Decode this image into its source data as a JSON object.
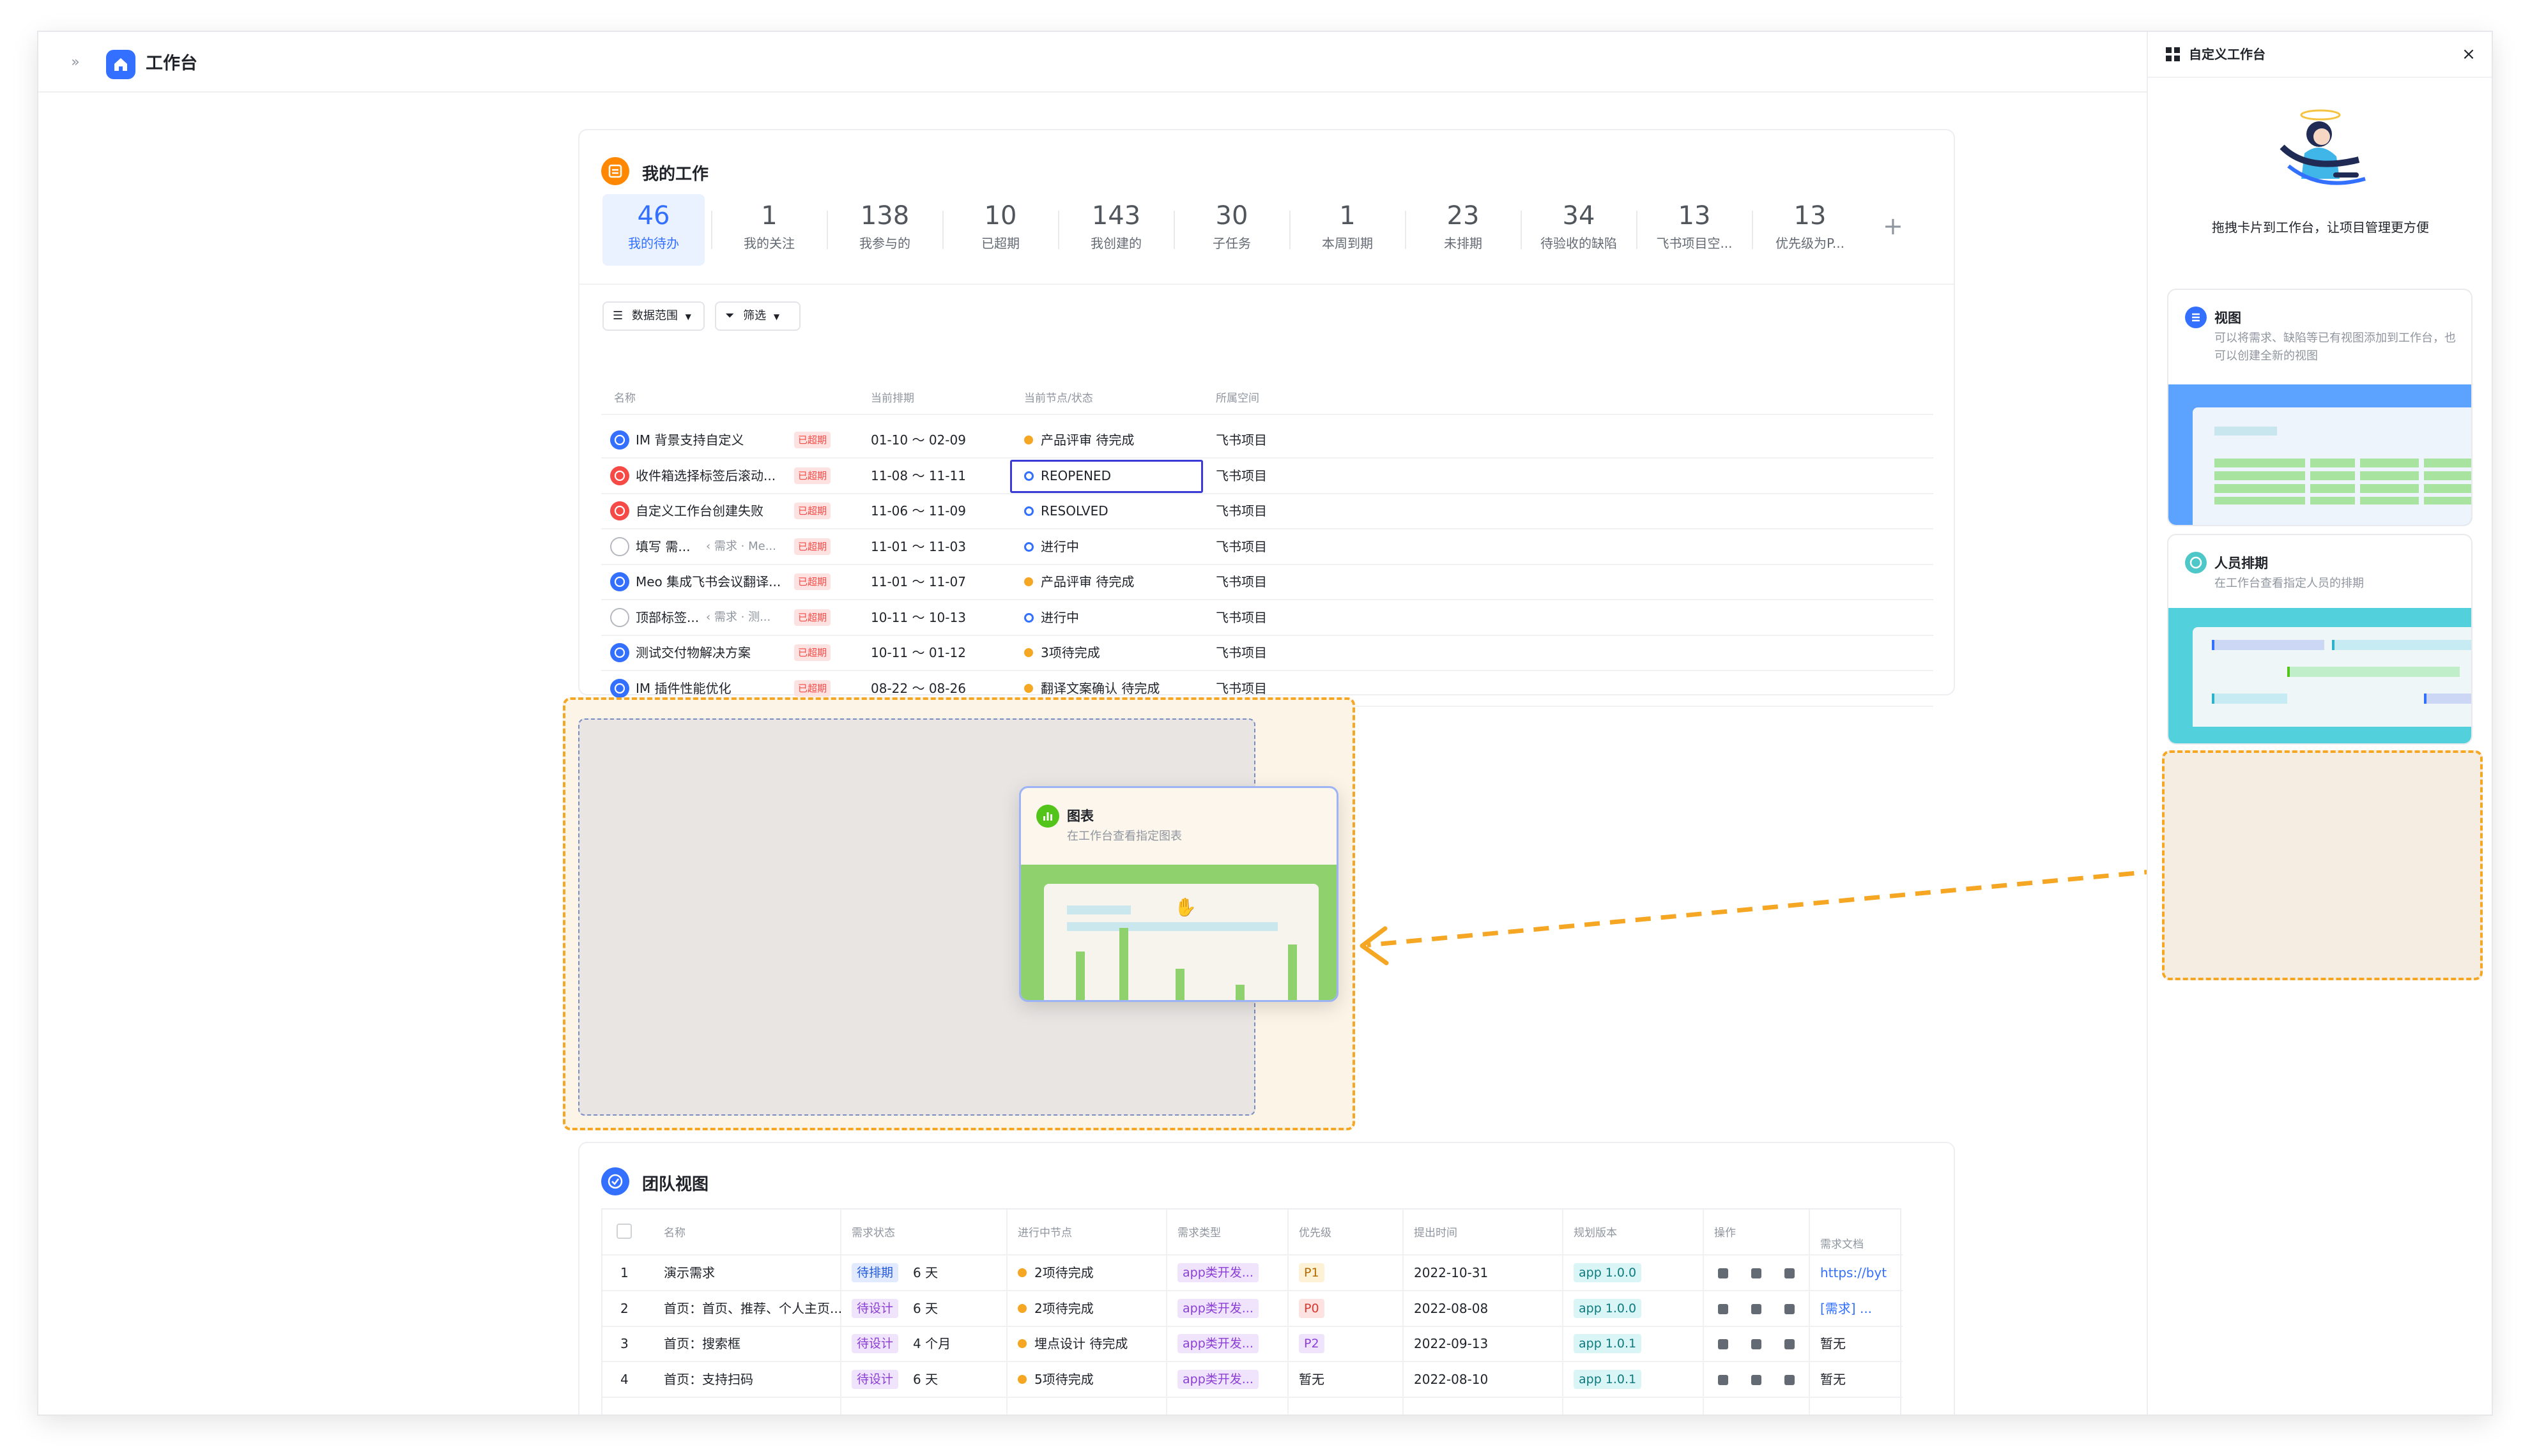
{
  "app": {
    "expand_glyph": "»",
    "title": "工作台"
  },
  "my_work": {
    "title": "我的工作",
    "stats": [
      {
        "value": "46",
        "label": "我的待办",
        "active": true
      },
      {
        "value": "1",
        "label": "我的关注"
      },
      {
        "value": "138",
        "label": "我参与的"
      },
      {
        "value": "10",
        "label": "已超期"
      },
      {
        "value": "143",
        "label": "我创建的"
      },
      {
        "value": "30",
        "label": "子任务"
      },
      {
        "value": "1",
        "label": "本周到期"
      },
      {
        "value": "23",
        "label": "未排期"
      },
      {
        "value": "34",
        "label": "待验收的缺陷"
      },
      {
        "value": "13",
        "label": "飞书项目空..."
      },
      {
        "value": "13",
        "label": "优先级为P..."
      }
    ],
    "add_label": "+",
    "scope_button": "数据范围",
    "filter_button": "筛选",
    "columns": [
      "名称",
      "当前排期",
      "当前节点/状态",
      "所属空间"
    ],
    "rows": [
      {
        "icon": "blue",
        "name": "IM 背景支持自定义",
        "sub": "",
        "badge": "已超期",
        "date": "01-10 ～ 02-09",
        "status": "产品评审 待完成",
        "status_type": "dot-orange",
        "space": "飞书项目"
      },
      {
        "icon": "red",
        "name": "收件箱选择标签后滚动...",
        "sub": "",
        "badge": "已超期",
        "date": "11-08 ～ 11-11",
        "status": "REOPENED",
        "status_type": "ring",
        "space": "飞书项目",
        "selected": true
      },
      {
        "icon": "red",
        "name": "自定义工作台创建失败",
        "sub": "",
        "badge": "已超期",
        "date": "11-06 ～ 11-09",
        "status": "RESOLVED",
        "status_type": "ring",
        "space": "飞书项目"
      },
      {
        "icon": "empty",
        "name": "填写 需...",
        "sub": "‹ 需求 · Me...",
        "badge": "已超期",
        "date": "11-01 ～ 11-03",
        "status": "进行中",
        "status_type": "ring",
        "space": "飞书项目"
      },
      {
        "icon": "blue",
        "name": "Meo 集成飞书会议翻译...",
        "sub": "",
        "badge": "已超期",
        "date": "11-01 ～ 11-07",
        "status": "产品评审 待完成",
        "status_type": "dot-orange",
        "space": "飞书项目"
      },
      {
        "icon": "empty",
        "name": "顶部标签...",
        "sub": "‹ 需求 · 测...",
        "badge": "已超期",
        "date": "10-11 ～ 10-13",
        "status": "进行中",
        "status_type": "ring",
        "space": "飞书项目"
      },
      {
        "icon": "blue",
        "name": "测试交付物解决方案",
        "sub": "",
        "badge": "已超期",
        "date": "10-11 ～ 01-12",
        "status": "3项待完成",
        "status_type": "dot-orange",
        "space": "飞书项目"
      },
      {
        "icon": "blue",
        "name": "IM 插件性能优化",
        "sub": "",
        "badge": "已超期",
        "date": "08-22 ～ 08-26",
        "status": "翻译文案确认 待完成",
        "status_type": "dot-orange",
        "space": "飞书项目"
      }
    ]
  },
  "dragging_card": {
    "title": "图表",
    "desc": "在工作台查看指定图表",
    "bar_levels": [
      0.42,
      0.62,
      0.27,
      0.13,
      0.48
    ]
  },
  "team_view": {
    "title": "团队视图",
    "columns": [
      "名称",
      "需求状态",
      "进行中节点",
      "需求类型",
      "优先级",
      "提出时间",
      "规划版本",
      "操作",
      "需求文档"
    ],
    "rows": [
      {
        "no": "1",
        "name": "演示需求",
        "state": "待排期",
        "state_color": "blue",
        "age": "6 天",
        "node": "2项待完成",
        "type": "app类开发...",
        "priority": "P1",
        "priority_color": "yellow",
        "date": "2022-10-31",
        "version": "app 1.0.0",
        "doc": "https://byt",
        "doc_link": true
      },
      {
        "no": "2",
        "name": "首页：首页、推荐、个人主页...",
        "state": "待设计",
        "state_color": "purple",
        "age": "6 天",
        "node": "2项待完成",
        "type": "app类开发...",
        "priority": "P0",
        "priority_color": "red",
        "date": "2022-08-08",
        "version": "app 1.0.0",
        "doc": "[需求] ...",
        "doc_link": true
      },
      {
        "no": "3",
        "name": "首页：搜索框",
        "state": "待设计",
        "state_color": "purple",
        "age": "4 个月",
        "node": "埋点设计 待完成",
        "type": "app类开发...",
        "priority": "P2",
        "priority_color": "purple",
        "date": "2022-09-13",
        "version": "app 1.0.1",
        "doc": "暂无",
        "doc_link": false
      },
      {
        "no": "4",
        "name": "首页：支持扫码",
        "state": "待设计",
        "state_color": "purple",
        "age": "6 天",
        "node": "5项待完成",
        "type": "app类开发...",
        "priority": "暂无",
        "priority_color": "none",
        "date": "2022-08-10",
        "version": "app 1.0.1",
        "doc": "暂无",
        "doc_link": false
      }
    ]
  },
  "panel": {
    "title": "自定义工作台",
    "close_glyph": "×",
    "hint": "拖拽卡片到工作台，让项目管理更方便",
    "widgets": [
      {
        "title": "视图",
        "desc": "可以将需求、缺陷等已有视图添加到工作台，也可以创建全新的视图"
      },
      {
        "title": "人员排期",
        "desc": "在工作台查看指定人员的排期"
      }
    ]
  },
  "colors": {
    "accent": "#3370ff",
    "drop_border": "#f5a623",
    "overdue_bg": "#fde2e2",
    "overdue_fg": "#f54a45",
    "green_card": "#8fd16d",
    "cyan_card": "#52d0dc",
    "blue_card": "#5ba3ff"
  }
}
